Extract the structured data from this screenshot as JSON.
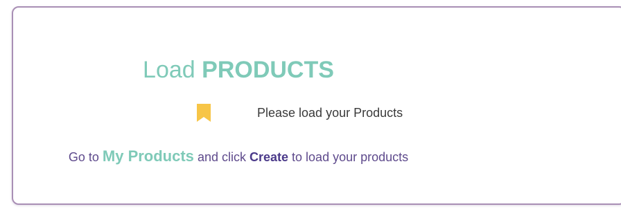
{
  "card": {
    "title_prefix": "Load",
    "title_emphasis": "PRODUCTS",
    "notice": {
      "icon": "bookmark-icon",
      "text": "Please load your Products"
    },
    "instruction": {
      "part1": "Go to",
      "products_link": "My Products",
      "part2": "and click",
      "create_link": "Create",
      "part3": "to load your products"
    }
  },
  "colors": {
    "accent_teal": "#7fcab8",
    "border_purple": "#a98fb5",
    "text_purple": "#5e4a8c",
    "bookmark_yellow": "#f7c547"
  }
}
